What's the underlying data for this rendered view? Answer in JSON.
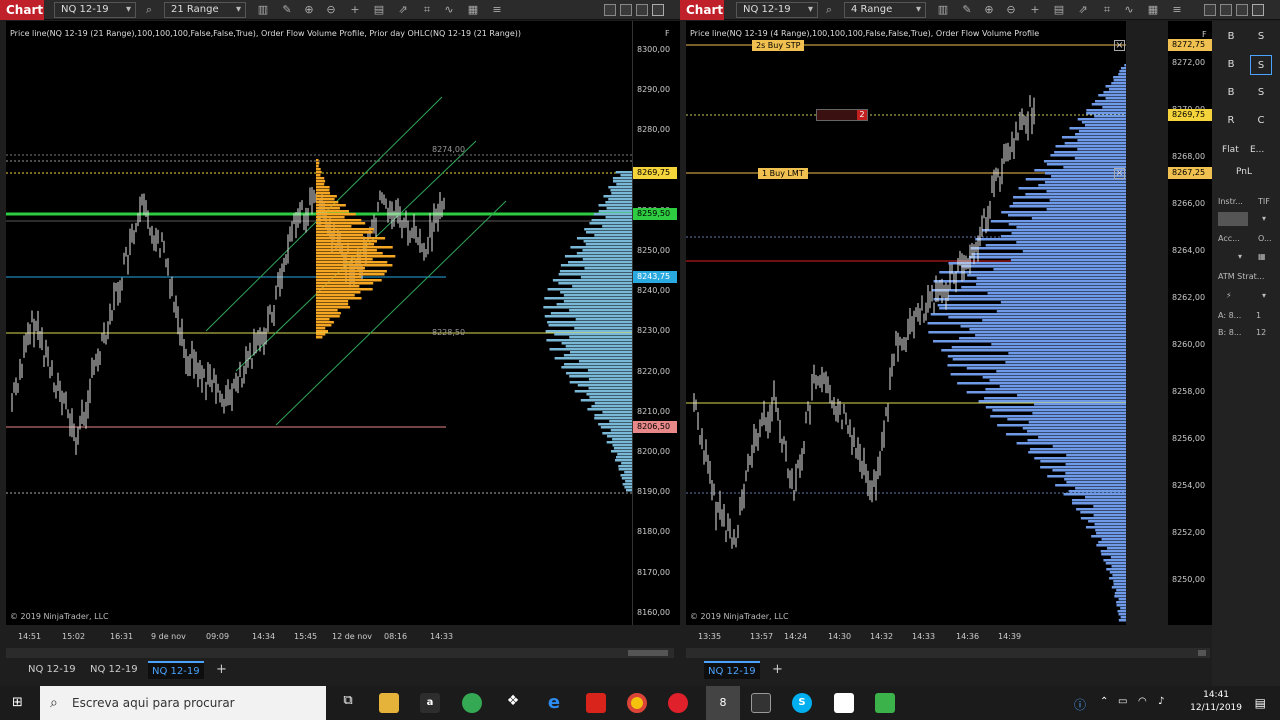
{
  "left": {
    "title": "Chart",
    "instrument": "NQ 12-19",
    "period": "21 Range",
    "label": "Price line(NQ 12-19 (21 Range),100,100,100,False,False,True), Order Flow Volume Profile, Prior day OHLC(NQ 12-19 (21 Range))",
    "copyright": "© 2019 NinjaTrader, LLC",
    "f_tag": "F",
    "yticks": [
      "8300,00",
      "8290,00",
      "8280,00",
      "8270,00",
      "8260,00",
      "8250,00",
      "8240,00",
      "8230,00",
      "8220,00",
      "8210,00",
      "8200,00",
      "8190,00",
      "8180,00",
      "8170,00",
      "8160,00"
    ],
    "badges": [
      {
        "text": "8269,75",
        "color": "#f5d33a"
      },
      {
        "text": "8259,50",
        "color": "#2ecc40"
      },
      {
        "text": "8243,75",
        "color": "#2aa9e0"
      },
      {
        "text": "8206,50",
        "color": "#e88888"
      }
    ],
    "profile_labels": [
      "8274,00",
      "8228,50"
    ],
    "xticks": [
      "14:51",
      "15:02",
      "16:31",
      "9 de nov",
      "09:09",
      "14:34",
      "15:45",
      "12 de nov",
      "08:16",
      "14:33"
    ],
    "tabs": [
      "NQ 12-19",
      "NQ 12-19",
      "NQ 12-19"
    ],
    "active_tab": 2,
    "add_tab": "+"
  },
  "right": {
    "title": "Chart",
    "instrument": "NQ 12-19",
    "period": "4 Range",
    "label": "Price line(NQ 12-19 (4 Range),100,100,100,False,False,True), Order Flow Volume Profile",
    "copyright": "© 2019 NinjaTrader, LLC",
    "f_tag": "F",
    "yticks": [
      "8272,00",
      "8270,00",
      "8268,00",
      "8266,00",
      "8264,00",
      "8262,00",
      "8260,00",
      "8258,00",
      "8256,00",
      "8254,00",
      "8252,00",
      "8250,00"
    ],
    "badges": [
      {
        "text": "8272,75",
        "color": "#f0c050"
      },
      {
        "text": "8269,75",
        "color": "#f5d33a"
      },
      {
        "text": "8267,25",
        "color": "#f0c050"
      }
    ],
    "orders": [
      {
        "text": "2s Buy STP",
        "color": "#f0c050"
      },
      {
        "text": "1 Buy LMT",
        "color": "#f0c050"
      }
    ],
    "order_qty": "2",
    "xticks": [
      "13:35",
      "13:57",
      "14:24",
      "14:30",
      "14:32",
      "14:33",
      "14:36",
      "14:39"
    ],
    "tabs": [
      "NQ 12-19"
    ],
    "add_tab": "+"
  },
  "side": {
    "buttons": [
      "B",
      "S",
      "B",
      "S",
      "B",
      "S",
      "R",
      "C"
    ],
    "flat": "Flat",
    "e": "E...",
    "pnl": "PnL",
    "instr": "Instr...",
    "tif": "TIF",
    "acc": "Acc...",
    "o": "O...",
    "atm": "ATM Strat...",
    "a_row": "A: 8...",
    "a_val": "1",
    "b_row": "B: 8...",
    "b_val": "12"
  },
  "taskbar": {
    "search_placeholder": "Escreva aqui para procurar",
    "time": "14:41",
    "date": "12/11/2019"
  }
}
